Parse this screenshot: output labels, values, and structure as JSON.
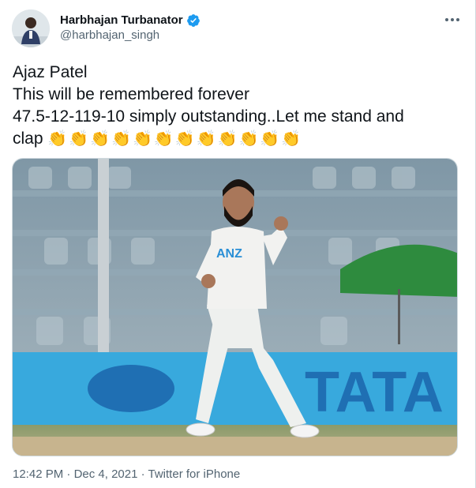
{
  "author": {
    "display_name": "Harbhajan Turbanator",
    "handle": "@harbhajan_singh",
    "avatar_icon": "user-avatar",
    "verified_icon": "verified-badge-icon",
    "verified_color": "#1d9bf0"
  },
  "tweet": {
    "lines": [
      "Ajaz Patel",
      "This will be remembered forever",
      "47.5-12-119-10 simply outstanding..Let me stand and",
      "clap"
    ],
    "emoji": "👏👏👏👏👏👏👏👏👏👏👏👏"
  },
  "media": {
    "jersey_text": "ANZ",
    "board_text": "TATA"
  },
  "meta": {
    "time": "12:42 PM",
    "separator": " · ",
    "date": "Dec 4, 2021",
    "source": "Twitter for iPhone"
  },
  "colors": {
    "text": "#0f1419",
    "secondary": "#536471",
    "board": "#38a9dd"
  }
}
